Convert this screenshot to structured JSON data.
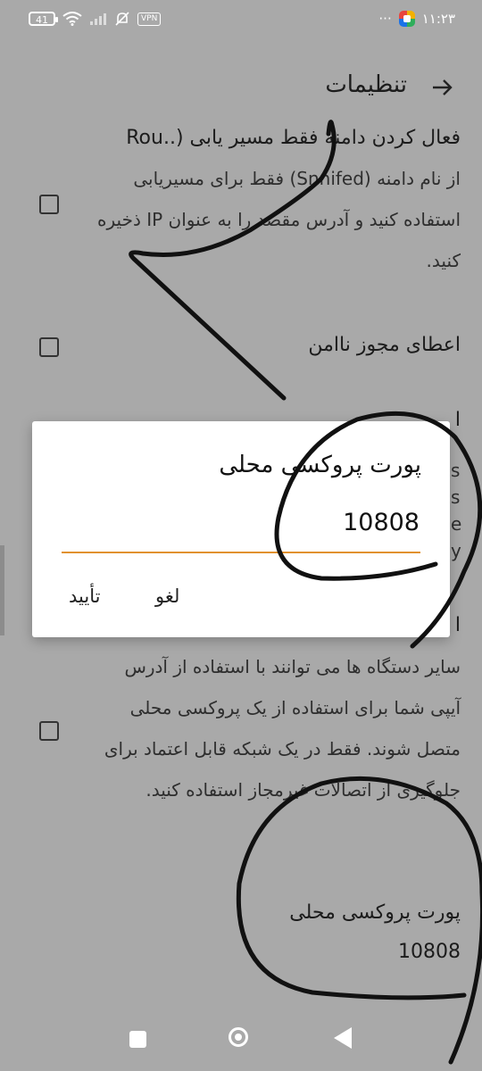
{
  "status_bar": {
    "battery": "41",
    "vpn_label": "VPN",
    "dots": "···",
    "time": "۱۱:۲۳"
  },
  "toolbar": {
    "title": "تنظیمات",
    "back_icon": "arrow-right-icon"
  },
  "settings": {
    "routing_title": "فعال کردن دامنه فقط مسیر یابی (..Rou",
    "routing_desc": "از نام دامنه (Snnifed) فقط برای مسیریابی استفاده کنید و آدرس مقصد را به عنوان IP ذخیره کنید.",
    "insecure_title": "اعطای مجوز ناامن",
    "partial_line": "ا",
    "lan_desc": "سایر دستگاه ها می توانند با استفاده از آدرس آیپی شما برای استفاده از یک پروکسی محلی متصل شوند. فقط در یک شبکه قابل اعتماد برای جلوگیری از اتصالات غیرمجاز استفاده کنید.",
    "local_proxy_title": "پورت پروکسی محلی",
    "local_proxy_value": "10808",
    "peek_letters": [
      "s",
      "s",
      "e",
      "y"
    ]
  },
  "dialog": {
    "title": "پورت پروکسی محلی",
    "input_value": "10808",
    "cancel_label": "لغو",
    "ok_label": "تأیید",
    "accent_color": "#e1912e"
  },
  "colors": {
    "overlay_background": "#a9a9a9",
    "dialog_background": "#ffffff"
  }
}
